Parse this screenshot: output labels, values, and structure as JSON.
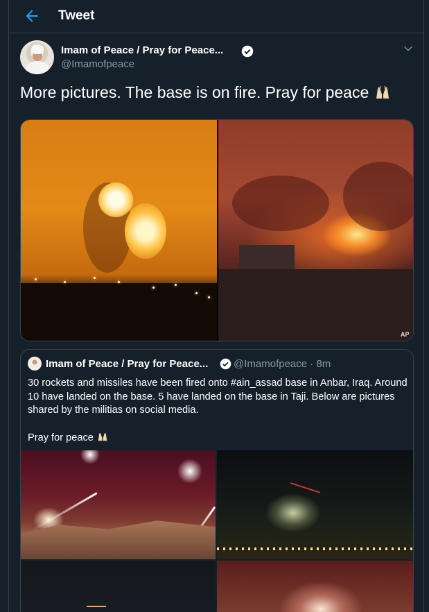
{
  "header": {
    "title": "Tweet"
  },
  "tweet": {
    "author_name": "Imam of Peace / Pray for Peace...",
    "author_handle": "@Imamofpeace",
    "text": "More pictures. The base is on fire. Pray for peace",
    "media_credit": "AP"
  },
  "quoted_tweet": {
    "author_name": "Imam of Peace / Pray for Peace...",
    "meta": "@Imamofpeace · 8m",
    "body_line1": "30 rockets and missiles have been fired onto #ain_assad base in Anbar, Iraq. Around 10 have landed on the base. 5 have landed on the base in Taji. Below are pictures shared by the militias on social media.",
    "body_line2": "Pray for peace"
  },
  "icons": {
    "back": "arrow-left-icon",
    "verified": "verified-badge-icon",
    "more": "chevron-down-icon",
    "emoji": "folded-hands-emoji"
  },
  "colors": {
    "accent": "#1da1f2",
    "background": "#15202b",
    "muted": "#8899a6",
    "border": "#38444d"
  }
}
